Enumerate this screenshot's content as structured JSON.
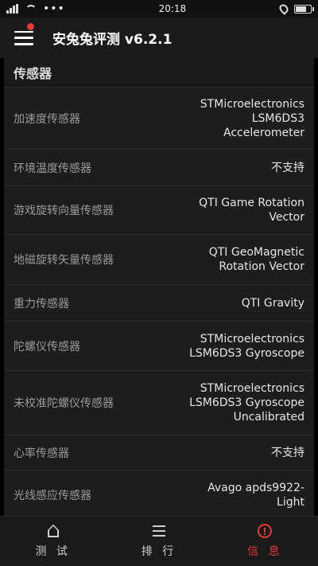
{
  "status_bar": {
    "time": "20:18",
    "dots": "•••"
  },
  "header": {
    "title": "安兔兔评测 v6.2.1"
  },
  "section": {
    "title": "传感器"
  },
  "rows": [
    {
      "label": "加速度传感器",
      "value": "STMicroelectronics\nLSM6DS3\nAccelerometer"
    },
    {
      "label": "环境温度传感器",
      "value": "不支持"
    },
    {
      "label": "游戏旋转向量传感器",
      "value": "QTI Game Rotation\nVector"
    },
    {
      "label": "地磁旋转矢量传感器",
      "value": "QTI GeoMagnetic\nRotation Vector"
    },
    {
      "label": "重力传感器",
      "value": "QTI Gravity"
    },
    {
      "label": "陀螺仪传感器",
      "value": "STMicroelectronics\nLSM6DS3 Gyroscope"
    },
    {
      "label": "未校准陀螺仪传感器",
      "value": "STMicroelectronics\nLSM6DS3 Gyroscope\nUncalibrated"
    },
    {
      "label": "心率传感器",
      "value": "不支持"
    },
    {
      "label": "光线感应传感器",
      "value": "Avago apds9922-\nLight"
    }
  ],
  "bottom_nav": [
    {
      "label": "测 试",
      "icon": "home-icon"
    },
    {
      "label": "排 行",
      "icon": "list-icon"
    },
    {
      "label": "信 息",
      "icon": "info-alert-icon",
      "active": true
    }
  ],
  "colors": {
    "accent": "#e53935",
    "background": "#1d1d1d"
  }
}
